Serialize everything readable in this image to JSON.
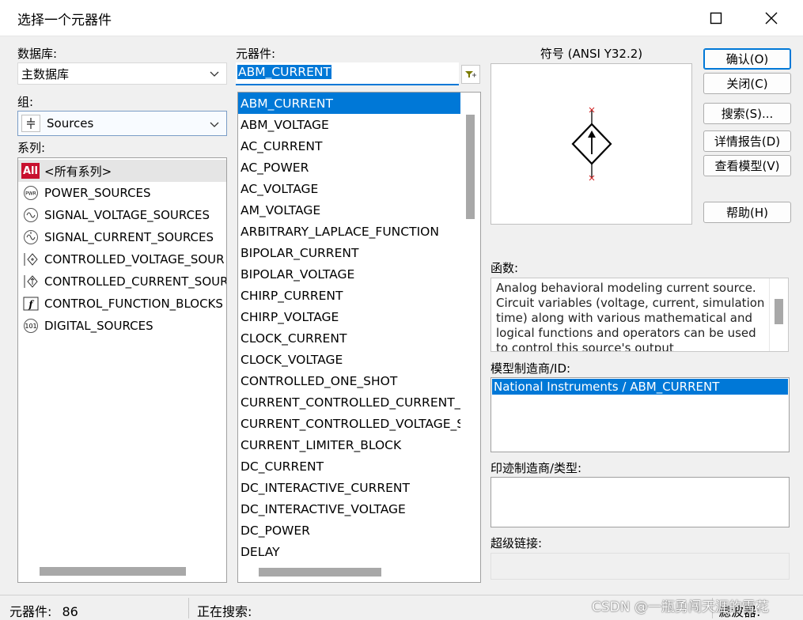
{
  "window": {
    "title": "选择一个元器件"
  },
  "database": {
    "label": "数据库:",
    "value": "主数据库"
  },
  "group": {
    "label": "组:",
    "value": "Sources"
  },
  "family": {
    "label": "系列:",
    "items": [
      {
        "icon": "All",
        "label": "<所有系列>"
      },
      {
        "icon": "PWR",
        "label": "POWER_SOURCES"
      },
      {
        "icon": "signal-voltage-icon",
        "label": "SIGNAL_VOLTAGE_SOURCES"
      },
      {
        "icon": "signal-current-icon",
        "label": "SIGNAL_CURRENT_SOURCES"
      },
      {
        "icon": "controlled-voltage-icon",
        "label": "CONTROLLED_VOLTAGE_SOUR"
      },
      {
        "icon": "controlled-current-icon",
        "label": "CONTROLLED_CURRENT_SOUR"
      },
      {
        "icon": "f",
        "label": "CONTROL_FUNCTION_BLOCKS"
      },
      {
        "icon": "101",
        "label": "DIGITAL_SOURCES"
      }
    ]
  },
  "component": {
    "label": "元器件:",
    "value": "ABM_CURRENT",
    "items": [
      "ABM_CURRENT",
      "ABM_VOLTAGE",
      "AC_CURRENT",
      "AC_POWER",
      "AC_VOLTAGE",
      "AM_VOLTAGE",
      "ARBITRARY_LAPLACE_FUNCTION",
      "BIPOLAR_CURRENT",
      "BIPOLAR_VOLTAGE",
      "CHIRP_CURRENT",
      "CHIRP_VOLTAGE",
      "CLOCK_CURRENT",
      "CLOCK_VOLTAGE",
      "CONTROLLED_ONE_SHOT",
      "CURRENT_CONTROLLED_CURRENT_S",
      "CURRENT_CONTROLLED_VOLTAGE_S",
      "CURRENT_LIMITER_BLOCK",
      "DC_CURRENT",
      "DC_INTERACTIVE_CURRENT",
      "DC_INTERACTIVE_VOLTAGE",
      "DC_POWER",
      "DELAY"
    ],
    "selected_index": 0
  },
  "symbol": {
    "label": "符号 (ANSI Y32.2)"
  },
  "function": {
    "label": "函数:",
    "text": "Analog behavioral modeling current source. Circuit variables (voltage, current, simulation time) along with various mathematical and logical functions and operators can be used to control this source's output"
  },
  "model_manufacturer": {
    "label": "模型制造商/ID:",
    "items": [
      "National Instruments / ABM_CURRENT"
    ]
  },
  "footprint": {
    "label": "印迹制造商/类型:"
  },
  "hyperlink": {
    "label": "超级链接:"
  },
  "buttons": {
    "ok": "确认(O)",
    "close": "关闭(C)",
    "search": "搜索(S)...",
    "detail_report": "详情报告(D)",
    "view_model": "查看模型(V)",
    "help": "帮助(H)"
  },
  "status": {
    "components_label": "元器件:",
    "components_count": "86",
    "searching_label": "正在搜索:",
    "filter_label": "滤波器:"
  },
  "watermark": "CSDN @一瓶勇闯天涯的雪花",
  "colors": {
    "selection": "#0078d7",
    "family_all_icon": "#c8102e",
    "symbol_terminal": "#d02020"
  }
}
